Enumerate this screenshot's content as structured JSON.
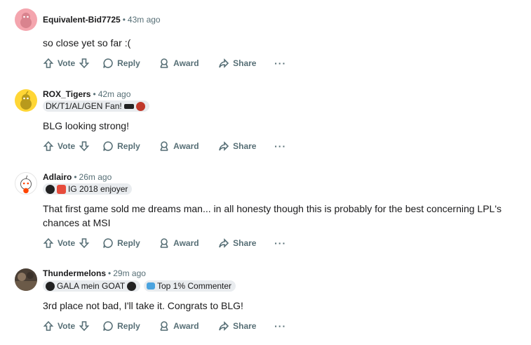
{
  "comments": [
    {
      "user": "Equivalent-Bid7725",
      "time": "43m ago",
      "flairs": [],
      "body": "so close yet so far :(",
      "avatar_color": "#f4a5ae"
    },
    {
      "user": "ROX_Tigers",
      "time": "42m ago",
      "flairs": [
        "DK/T1/AL/GEN Fan!"
      ],
      "body": "BLG looking strong!",
      "avatar_color": "#ffd635"
    },
    {
      "user": "Adlairo",
      "time": "26m ago",
      "flairs": [
        "IG 2018 enjoyer"
      ],
      "body": "That first game sold me dreams man... in all honesty though this is probably for the best concerning LPL's chances at MSI",
      "avatar_color": "#ffffff"
    },
    {
      "user": "Thundermelons",
      "time": "29m ago",
      "flairs": [
        "GALA mein GOAT",
        "Top 1% Commenter"
      ],
      "body": "3rd place not bad, I'll take it. Congrats to BLG!",
      "avatar_color": "#4a3f35"
    }
  ],
  "actions": {
    "vote": "Vote",
    "reply": "Reply",
    "award": "Award",
    "share": "Share",
    "more": "···"
  },
  "icons": {
    "upvote": "arrow-up-icon",
    "downvote": "arrow-down-icon",
    "reply": "speech-bubble-icon",
    "award": "award-icon",
    "share": "share-arrow-icon",
    "more": "ellipsis-icon"
  },
  "colors": {
    "meta": "#576f76",
    "flair_bg": "#e9ecef",
    "text": "#1a1a1b"
  }
}
